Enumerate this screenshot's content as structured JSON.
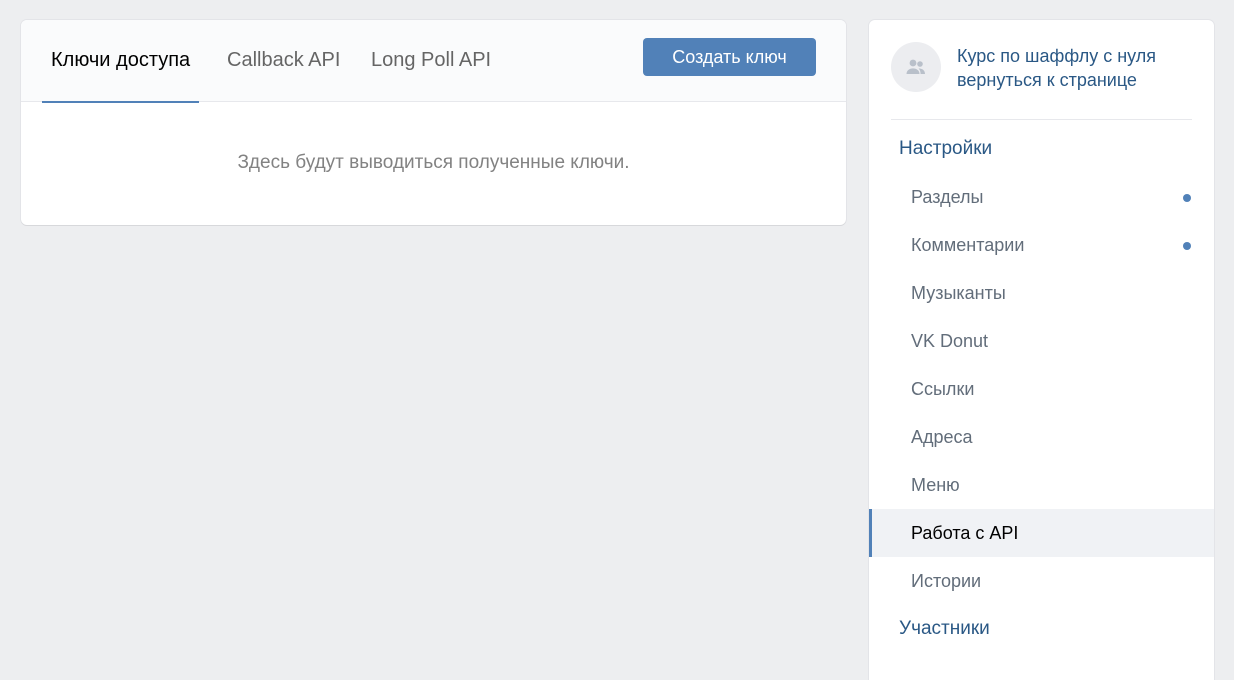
{
  "tabs": [
    {
      "label": "Ключи доступа",
      "active": true
    },
    {
      "label": "Callback API",
      "active": false
    },
    {
      "label": "Long Poll API",
      "active": false
    }
  ],
  "create_button_label": "Создать ключ",
  "empty_message": "Здесь будут выводиться полученные ключи.",
  "group": {
    "name": "Курс по шаффлу с нуля",
    "back_link": "вернуться к странице",
    "avatar_icon": "users-icon"
  },
  "sidebar": {
    "settings_label": "Настройки",
    "items": [
      {
        "label": "Разделы",
        "dot": true
      },
      {
        "label": "Комментарии",
        "dot": true
      },
      {
        "label": "Музыканты",
        "dot": false
      },
      {
        "label": "VK Donut",
        "dot": false
      },
      {
        "label": "Ссылки",
        "dot": false
      },
      {
        "label": "Адреса",
        "dot": false
      },
      {
        "label": "Меню",
        "dot": false
      },
      {
        "label": "Работа с API",
        "dot": false,
        "selected": true
      },
      {
        "label": "Истории",
        "dot": false
      }
    ],
    "members_label": "Участники"
  },
  "colors": {
    "accent": "#5181b8",
    "link": "#2a5885",
    "background": "#edeef0"
  }
}
